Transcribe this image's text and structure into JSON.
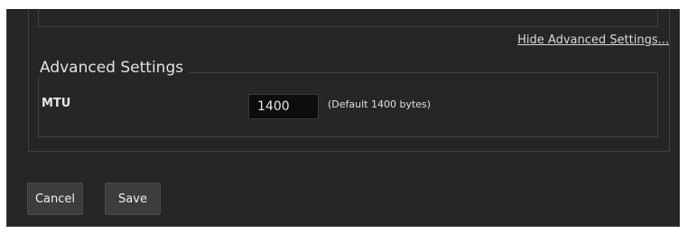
{
  "advanced": {
    "hide_link": "Hide Advanced Settings...",
    "legend": "Advanced Settings",
    "mtu_label": "MTU",
    "mtu_value": "1400",
    "mtu_hint": "(Default 1400 bytes)"
  },
  "actions": {
    "cancel_label": "Cancel",
    "save_label": "Save"
  },
  "colors": {
    "background": "#262626",
    "border": "#404040",
    "input_background": "#0d0d0d",
    "button_background": "#3d3d3d",
    "text": "#e2e2e2"
  }
}
